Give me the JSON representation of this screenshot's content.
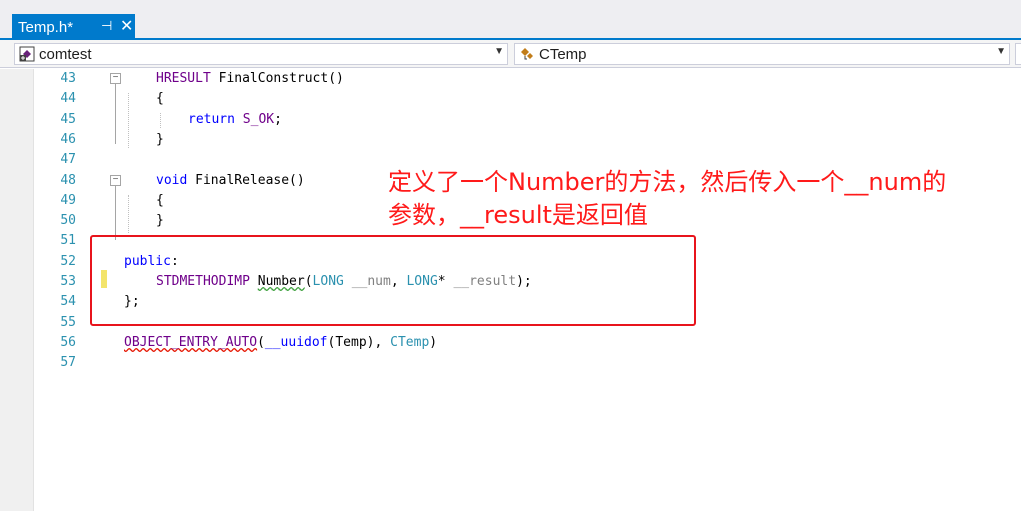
{
  "tab": {
    "title": "Temp.h*",
    "pin_glyph": "⊣",
    "close_glyph": "✕"
  },
  "nav": {
    "project": "comtest",
    "scope": "CTemp"
  },
  "lines": [
    {
      "num": "43",
      "fold": "−",
      "indent": 1,
      "tokens": [
        {
          "t": "HRESULT",
          "c": "macro"
        },
        {
          "t": " FinalConstruct()",
          "c": ""
        }
      ]
    },
    {
      "num": "44",
      "indent": 1,
      "tokens": [
        {
          "t": "{",
          "c": ""
        }
      ]
    },
    {
      "num": "45",
      "indent": 2,
      "tokens": [
        {
          "t": "return",
          "c": "kw"
        },
        {
          "t": " ",
          "c": ""
        },
        {
          "t": "S_OK",
          "c": "macro"
        },
        {
          "t": ";",
          "c": ""
        }
      ]
    },
    {
      "num": "46",
      "indent": 1,
      "tokens": [
        {
          "t": "}",
          "c": ""
        }
      ]
    },
    {
      "num": "47",
      "indent": 0,
      "tokens": []
    },
    {
      "num": "48",
      "fold": "−",
      "indent": 1,
      "tokens": [
        {
          "t": "void",
          "c": "kw"
        },
        {
          "t": " FinalRelease()",
          "c": ""
        }
      ]
    },
    {
      "num": "49",
      "indent": 1,
      "tokens": [
        {
          "t": "{",
          "c": ""
        }
      ]
    },
    {
      "num": "50",
      "indent": 1,
      "tokens": [
        {
          "t": "}",
          "c": ""
        }
      ]
    },
    {
      "num": "51",
      "indent": 0,
      "tokens": []
    },
    {
      "num": "52",
      "indent": 0,
      "tokens": [
        {
          "t": "public",
          "c": "kw"
        },
        {
          "t": ":",
          "c": ""
        }
      ]
    },
    {
      "num": "53",
      "indent": 1,
      "tokens": [
        {
          "t": "STDMETHODIMP",
          "c": "macro"
        },
        {
          "t": " ",
          "c": ""
        },
        {
          "t": "Number",
          "c": "squiggle"
        },
        {
          "t": "(",
          "c": ""
        },
        {
          "t": "LONG",
          "c": "type"
        },
        {
          "t": " ",
          "c": ""
        },
        {
          "t": "__num",
          "c": "param"
        },
        {
          "t": ", ",
          "c": ""
        },
        {
          "t": "LONG",
          "c": "type"
        },
        {
          "t": "* ",
          "c": ""
        },
        {
          "t": "__result",
          "c": "param"
        },
        {
          "t": ");",
          "c": ""
        }
      ]
    },
    {
      "num": "54",
      "indent": 0,
      "tokens": [
        {
          "t": "};",
          "c": ""
        }
      ]
    },
    {
      "num": "55",
      "indent": 0,
      "tokens": []
    },
    {
      "num": "56",
      "indent": 0,
      "tokens": [
        {
          "t": "OBJECT_ENTRY_AUTO",
          "c": "macro squiggle-red"
        },
        {
          "t": "(",
          "c": ""
        },
        {
          "t": "__uuidof",
          "c": "kw"
        },
        {
          "t": "(Temp), ",
          "c": ""
        },
        {
          "t": "CTemp",
          "c": "type"
        },
        {
          "t": ")",
          "c": ""
        }
      ]
    },
    {
      "num": "57",
      "indent": 0,
      "tokens": []
    }
  ],
  "annotation": {
    "line1": "定义了一个Number的方法，然后传入一个__num的",
    "line2": "参数，__result是返回值"
  },
  "colors": {
    "accent": "#007acc",
    "annotation": "#ff1a1a",
    "box": "#e8141c"
  }
}
